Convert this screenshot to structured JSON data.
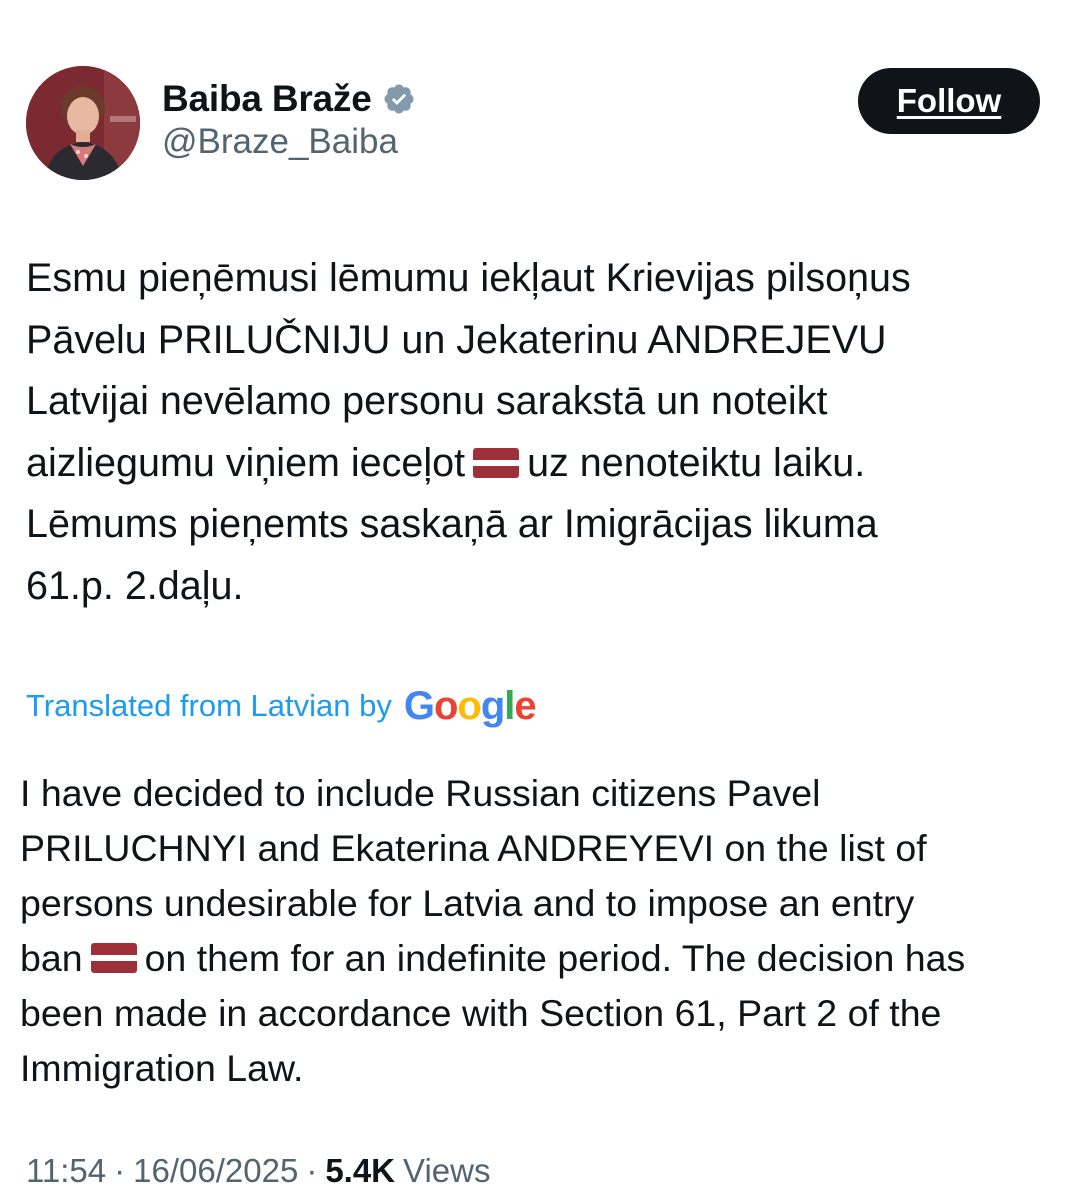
{
  "author": {
    "name": "Baiba Braže",
    "handle": "@Braze_Baiba",
    "verified": true
  },
  "follow_button": {
    "label": "Follow"
  },
  "tweet": {
    "original_lines": [
      {
        "before": "Esmu pieņēmusi lēmumu iekļaut Krievijas pilsoņus"
      },
      {
        "before": "Pāvelu PRILUČNIJU u",
        "highlight": "n Jekaterinu ANDREJEVU"
      },
      {
        "before": "Latvijai nevēlamo personu sarakstā un noteikt"
      },
      {
        "before": "aizliegumu viņiem iecеļot",
        "flag": "latvia-flag",
        "after": "uz nenoteiktu laiku."
      },
      {
        "before": "Lēmums pieņemts saskaņā ar Imigrācijas likuma"
      },
      {
        "before": "61.p. 2.daļu."
      }
    ],
    "translation_label": "Translated from Latvian by",
    "translation_brand": "Google",
    "translated_lines": [
      {
        "before": "I have decided to include Russian citizens Pavel"
      },
      {
        "before": "PRILUCHNYI and Ekaterina ANDREYEVI on the list of"
      },
      {
        "before": "persons undesirable for Latvia and to impose an entry"
      },
      {
        "before": "ban",
        "flag": "latvia-flag",
        "after": "on them for an indefinite period. The decision has"
      },
      {
        "before": "been made in accordance with Section 61, Part 2 of the"
      },
      {
        "before": "Immigration Law."
      }
    ]
  },
  "meta": {
    "time": "11:54",
    "date": "16/06/2025",
    "separator": "·",
    "views_count": "5.4K",
    "views_label": "Views"
  },
  "colors": {
    "text": "#0f1419",
    "secondary": "#536471",
    "link": "#1d9bf0",
    "highlight": "#f8d21a",
    "flag_red": "#9e3039"
  },
  "icons": [
    "verified-badge-icon",
    "latvia-flag-icon"
  ]
}
